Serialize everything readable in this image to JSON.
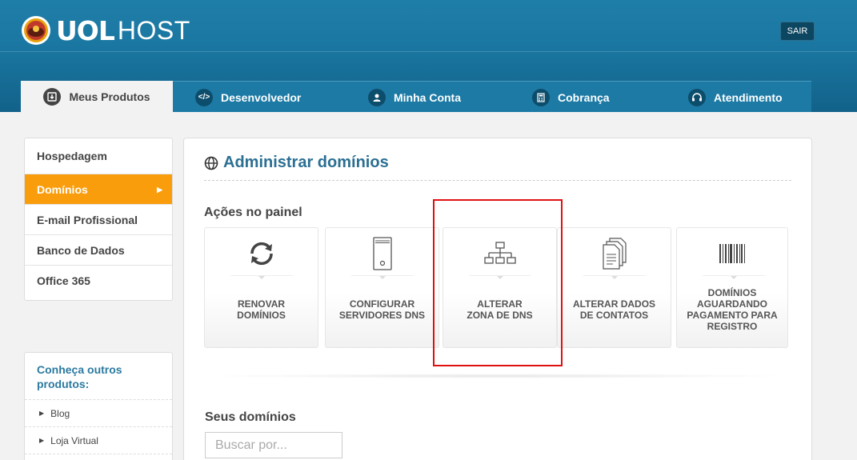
{
  "header": {
    "logo_primary": "UOL",
    "logo_secondary": "HOST",
    "logout_label": "SAIR"
  },
  "nav": {
    "tabs": [
      {
        "label": "Meus Produtos",
        "icon": "download-box-icon",
        "active": true
      },
      {
        "label": "Desenvolvedor",
        "icon": "code-icon",
        "active": false
      },
      {
        "label": "Minha Conta",
        "icon": "user-icon",
        "active": false
      },
      {
        "label": "Cobrança",
        "icon": "calculator-icon",
        "active": false
      },
      {
        "label": "Atendimento",
        "icon": "headset-icon",
        "active": false
      }
    ]
  },
  "sidebar": {
    "items": [
      {
        "label": "Hospedagem",
        "active": false
      },
      {
        "label": "Domínios",
        "active": true
      },
      {
        "label": "E-mail Profissional",
        "active": false
      },
      {
        "label": "Banco de Dados",
        "active": false
      },
      {
        "label": "Office 365",
        "active": false
      }
    ]
  },
  "sidebar_products": {
    "title": "Conheça outros produtos:",
    "items": [
      {
        "label": "Blog"
      },
      {
        "label": "Loja Virtual"
      }
    ]
  },
  "main": {
    "title": "Administrar domínios",
    "actions_title": "Ações no painel",
    "actions": [
      {
        "label": "RENOVAR\nDOMÍNIOS",
        "icon": "refresh-icon"
      },
      {
        "label": "CONFIGURAR\nSERVIDORES DNS",
        "icon": "server-icon"
      },
      {
        "label": "ALTERAR\nZONA DE DNS",
        "icon": "network-tree-icon"
      },
      {
        "label": "ALTERAR DADOS\nDE CONTATOS",
        "icon": "documents-icon"
      },
      {
        "label": "DOMÍNIOS\nAGUARDANDO\nPAGAMENTO PARA\nREGISTRO",
        "icon": "barcode-icon"
      }
    ],
    "domains_title": "Seus domínios",
    "search_placeholder": "Buscar por..."
  },
  "colors": {
    "header_blue": "#1a77a1",
    "active_orange": "#f99d0c",
    "title_blue": "#2b6f93",
    "highlight_red": "#e01010"
  }
}
